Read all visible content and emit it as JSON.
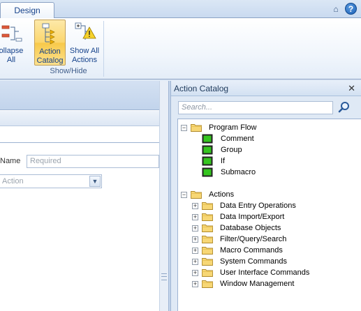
{
  "ribbon": {
    "active_tab": "Design",
    "buttons": {
      "collapse_all": "ollapse\nAll",
      "action_catalog": "Action\nCatalog",
      "show_all_actions": "Show All\nActions"
    },
    "group_label": "Show/Hide",
    "minimize_glyph": "⌂",
    "help_glyph": "?"
  },
  "editor": {
    "name_label": "Name",
    "name_placeholder": "Required",
    "action_placeholder": "Action"
  },
  "catalog": {
    "title": "Action Catalog",
    "close_glyph": "✕",
    "search_placeholder": "Search...",
    "program_flow": {
      "label": "Program Flow",
      "expander": "−",
      "items": [
        "Comment",
        "Group",
        "If",
        "Submacro"
      ]
    },
    "actions": {
      "label": "Actions",
      "expander": "−",
      "folders": [
        "Data Entry Operations",
        "Data Import/Export",
        "Database Objects",
        "Filter/Query/Search",
        "Macro Commands",
        "System Commands",
        "User Interface Commands",
        "Window Management"
      ]
    }
  },
  "colors": {
    "accent_highlight": "#fbd66d",
    "ribbon_text": "#15428b",
    "action_icon_green": "#2fbf1f"
  },
  "icons": {
    "collapse_all": "collapse-tree-icon",
    "action_catalog": "action-catalog-icon",
    "show_all_actions": "warning-list-icon",
    "search": "magnifier-icon",
    "folder": "folder-icon",
    "action": "green-action-icon"
  }
}
